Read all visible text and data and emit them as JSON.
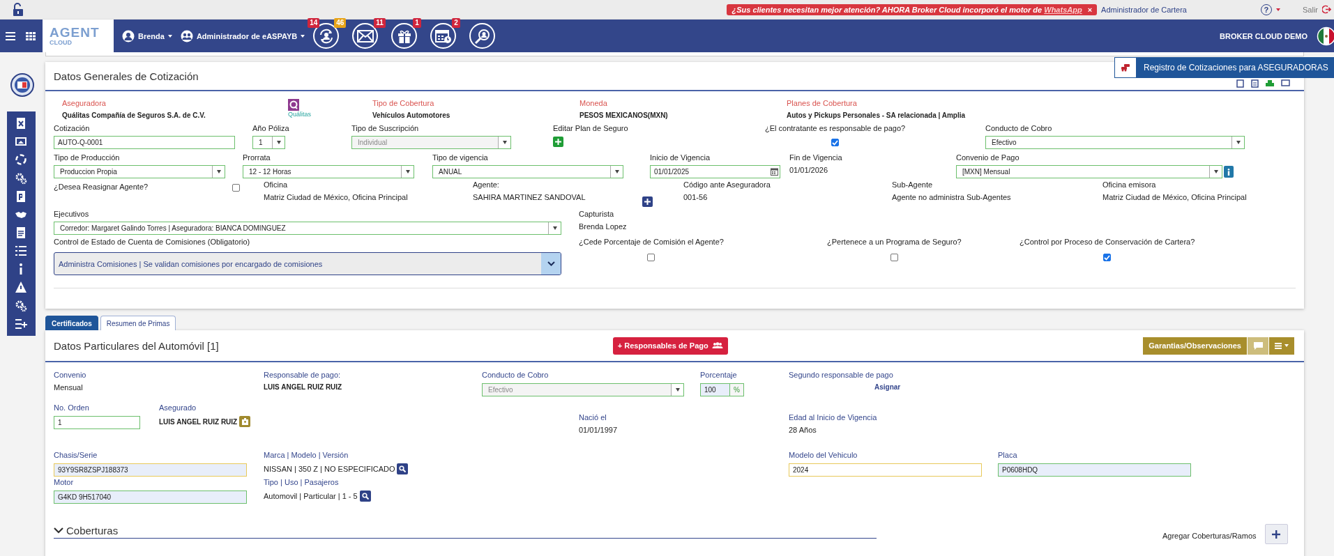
{
  "top_bar": {
    "promo_text": "¿Sus clientes necesitan mejor atención? AHORA Broker Cloud incorporó el motor de ",
    "promo_link": "WhatsApp",
    "promo_close": "×",
    "role": "Administrador de Cartera",
    "help": "?",
    "logout": "Salir"
  },
  "navbar": {
    "logo_top": "AGENT",
    "logo_bottom": "CLOUD",
    "user": "Brenda",
    "profile": "Administrador de eASPAYB",
    "shortcuts": [
      {
        "kind": "users-sync",
        "badges": [
          {
            "count": "14",
            "color": "#d0253c"
          },
          {
            "count": "46",
            "color": "#e8a317"
          }
        ]
      },
      {
        "kind": "mail",
        "badges": [
          {
            "count": "11",
            "color": "#d0253c"
          }
        ]
      },
      {
        "kind": "gift",
        "badges": [
          {
            "count": "1",
            "color": "#d0253c"
          }
        ]
      },
      {
        "kind": "calendar",
        "badges": [
          {
            "count": "2",
            "color": "#d0253c"
          }
        ]
      },
      {
        "kind": "user-search"
      }
    ],
    "brand": "BROKER CLOUD DEMO"
  },
  "quote_registry": "Registro de Cotizaciones para ASEGURADORAS",
  "general": {
    "title": "Datos Generales de Cotización",
    "summary": [
      {
        "kind": "info",
        "label": "Aseguradora",
        "value": "Quálitas Compañía de Seguros S.A. de C.V."
      },
      {
        "kind": "logo",
        "caption": "Quálitas"
      },
      {
        "kind": "info",
        "label": "Tipo de Cobertura",
        "value": "Vehículos Automotores"
      },
      {
        "kind": "info",
        "label": "Moneda",
        "value": "PESOS MEXICANOS(MXN)"
      },
      {
        "kind": "info",
        "label": "Planes de Cobertura",
        "value": "Autos y Pickups Personales - SA relacionada | Amplia"
      }
    ],
    "fields": [
      {
        "kind": "input",
        "label": "Cotización",
        "value": "AUTO-Q-0001"
      },
      {
        "kind": "select",
        "label": "Año Póliza",
        "value": "1",
        "disabled": false
      },
      {
        "kind": "select",
        "label": "Tipo de Suscripción",
        "value": "Individual",
        "disabled": true
      },
      {
        "kind": "add",
        "label": "Editar Plan de Seguro",
        "color": "#1f9d36"
      },
      {
        "kind": "checkbox",
        "label": "¿El contratante es responsable de pago?",
        "checked": true
      },
      {
        "kind": "select",
        "label": "Conducto de Cobro",
        "value": "Efectivo",
        "disabled": false
      },
      {
        "kind": "select",
        "label": "Tipo de Producción",
        "value": "Produccion Propia",
        "disabled": false
      },
      {
        "kind": "select",
        "label": "Prorrata",
        "value": "12 - 12 Horas",
        "disabled": false
      },
      {
        "kind": "select",
        "label": "Tipo de vigencia",
        "value": "ANUAL",
        "disabled": false
      },
      {
        "kind": "date",
        "label": "Inicio de Vigencia",
        "value": "01/01/2025"
      },
      {
        "kind": "text",
        "label": "Fin de Vigencia",
        "value": "01/01/2026"
      },
      {
        "kind": "select-info",
        "label": "Convenio de Pago",
        "value": "[MXN] Mensual",
        "disabled": false
      },
      {
        "kind": "inline-checkbox",
        "label": "¿Desea Reasignar Agente?",
        "checked": false
      },
      {
        "kind": "text",
        "label": "Oficina",
        "value": "Matriz Ciudad de México, Oficina Principal"
      },
      {
        "kind": "text",
        "label": "Agente:",
        "value": "SAHIRA MARTINEZ SANDOVAL"
      },
      {
        "kind": "add",
        "color": "#2f4287"
      },
      {
        "kind": "text",
        "label": "Código ante Aseguradora",
        "value": "001-56"
      },
      {
        "kind": "text",
        "label": "Sub-Agente",
        "value": "Agente no administra Sub-Agentes"
      },
      {
        "kind": "text",
        "label": "Oficina emisora",
        "value": "Matriz Ciudad de México, Oficina Principal"
      },
      {
        "kind": "select",
        "label": "Ejecutivos",
        "value": "Corredor: Margaret Galindo Torres | Aseguradora: BIANCA DOMINGUEZ",
        "disabled": false
      },
      {
        "kind": "text",
        "label": "Capturista",
        "value": "Brenda Lopez"
      },
      {
        "kind": "big-select",
        "label": "Control de Estado de Cuenta de Comisiones (Obligatorio)",
        "value": "Administra Comisiones | Se validan comisiones por encargado de comisiones"
      },
      {
        "kind": "checkbox",
        "label": "¿Cede Porcentaje de Comisión el Agente?",
        "checked": false
      },
      {
        "kind": "checkbox",
        "label": "¿Pertenece a un Programa de Seguro?",
        "checked": false
      },
      {
        "kind": "checkbox",
        "label": "¿Control por Proceso de Conservación de Cartera?",
        "checked": true
      }
    ]
  },
  "tabs": [
    {
      "label": "Certificados",
      "selected": true
    },
    {
      "label": "Resumen de Primas",
      "selected": false
    }
  ],
  "vehicle": {
    "title": "Datos Particulares del Automóvil [1]",
    "payers_button": "+ Responsables de Pago",
    "guarantees_button": "Garantias/Observaciones",
    "fields": [
      {
        "kind": "text",
        "label": "Convenio",
        "value": "Mensual"
      },
      {
        "kind": "strong",
        "label": "Responsable de pago:",
        "value": "LUIS ANGEL RUIZ RUIZ"
      },
      {
        "kind": "select",
        "label": "Conducto de Cobro",
        "value": "Efectivo",
        "disabled": true
      },
      {
        "kind": "percent",
        "label": "Porcentaje",
        "value": "100",
        "unit": "%"
      },
      {
        "kind": "link",
        "label": "Segundo responsable de pago",
        "value": "Asignar"
      },
      {
        "kind": "input",
        "label": "No. Orden",
        "value": "1",
        "warning": false,
        "autofilled": false
      },
      {
        "kind": "person",
        "label": "Asegurado",
        "value": "LUIS ANGEL RUIZ RUIZ"
      },
      {
        "kind": "text",
        "label": "Nació el",
        "value": "01/01/1997"
      },
      {
        "kind": "text",
        "label": "Edad al Inicio de Vigencia",
        "value": "28 Años"
      },
      {
        "kind": "input",
        "label": "Chasis/Serie",
        "value": "93Y9SR8ZSPJ188373",
        "warning": true,
        "autofilled": true
      },
      {
        "kind": "lookup",
        "label": "Marca | Modelo | Versión",
        "value": "NISSAN | 350 Z | NO ESPECIFICADO"
      },
      {
        "kind": "input",
        "label": "Modelo del Vehiculo",
        "value": "2024",
        "warning": true,
        "autofilled": false
      },
      {
        "kind": "input",
        "label": "Placa",
        "value": "P0608HDQ",
        "warning": false,
        "autofilled": true
      },
      {
        "kind": "input",
        "label": "Motor",
        "value": "G4KD 9H517040",
        "warning": false,
        "autofilled": true
      },
      {
        "kind": "lookup",
        "label": "Tipo | Uso | Pasajeros",
        "value": "Automovil | Particular | 1 - 5"
      }
    ],
    "coverages": {
      "title": "Coberturas",
      "add_label": "Agregar Coberturas/Ramos"
    }
  }
}
